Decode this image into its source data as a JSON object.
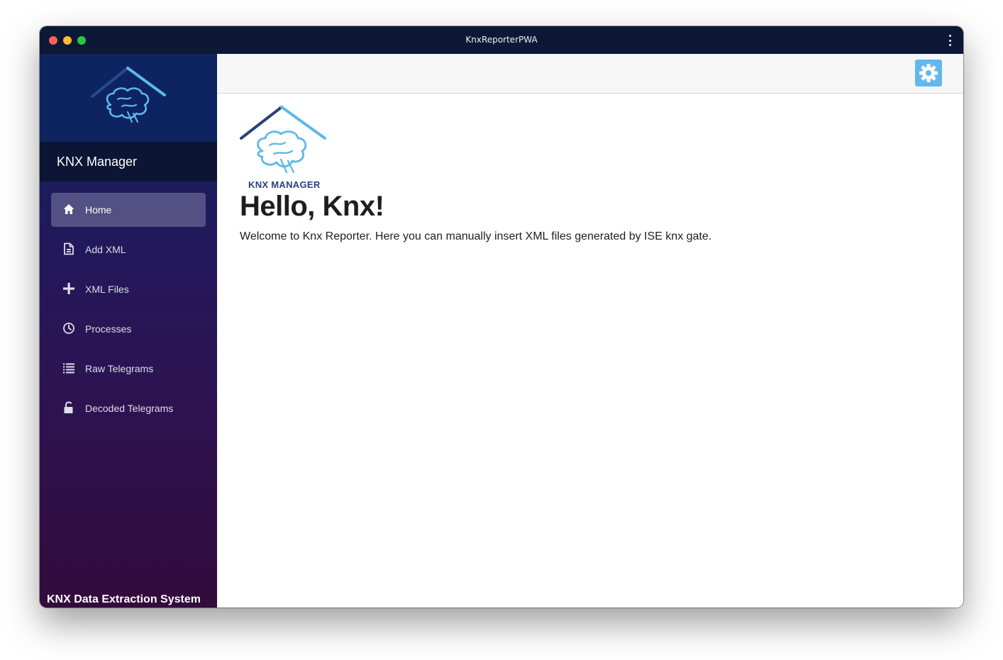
{
  "window": {
    "title": "KnxReporterPWA"
  },
  "sidebar": {
    "brand": "KNX Manager",
    "items": [
      {
        "label": "Home",
        "icon": "home-icon",
        "active": true
      },
      {
        "label": "Add XML",
        "icon": "document-icon",
        "active": false
      },
      {
        "label": "XML Files",
        "icon": "plus-icon",
        "active": false
      },
      {
        "label": "Processes",
        "icon": "clock-icon",
        "active": false
      },
      {
        "label": "Raw Telegrams",
        "icon": "list-icon",
        "active": false
      },
      {
        "label": "Decoded Telegrams",
        "icon": "unlock-icon",
        "active": false
      }
    ],
    "footer": "KNX Data Extraction System"
  },
  "topbar": {
    "settings_icon": "gear-icon"
  },
  "main": {
    "logo_caption": "KNX MANAGER",
    "title": "Hello, Knx!",
    "welcome": "Welcome to Knx Reporter. Here you can manually insert XML files generated by ISE knx gate."
  },
  "colors": {
    "titlebar": "#0c1836",
    "sidebar_top": "#0e2462",
    "sidebar_bottom": "#330b3c",
    "accent": "#60b8ec",
    "logo_dark": "#27427a"
  }
}
